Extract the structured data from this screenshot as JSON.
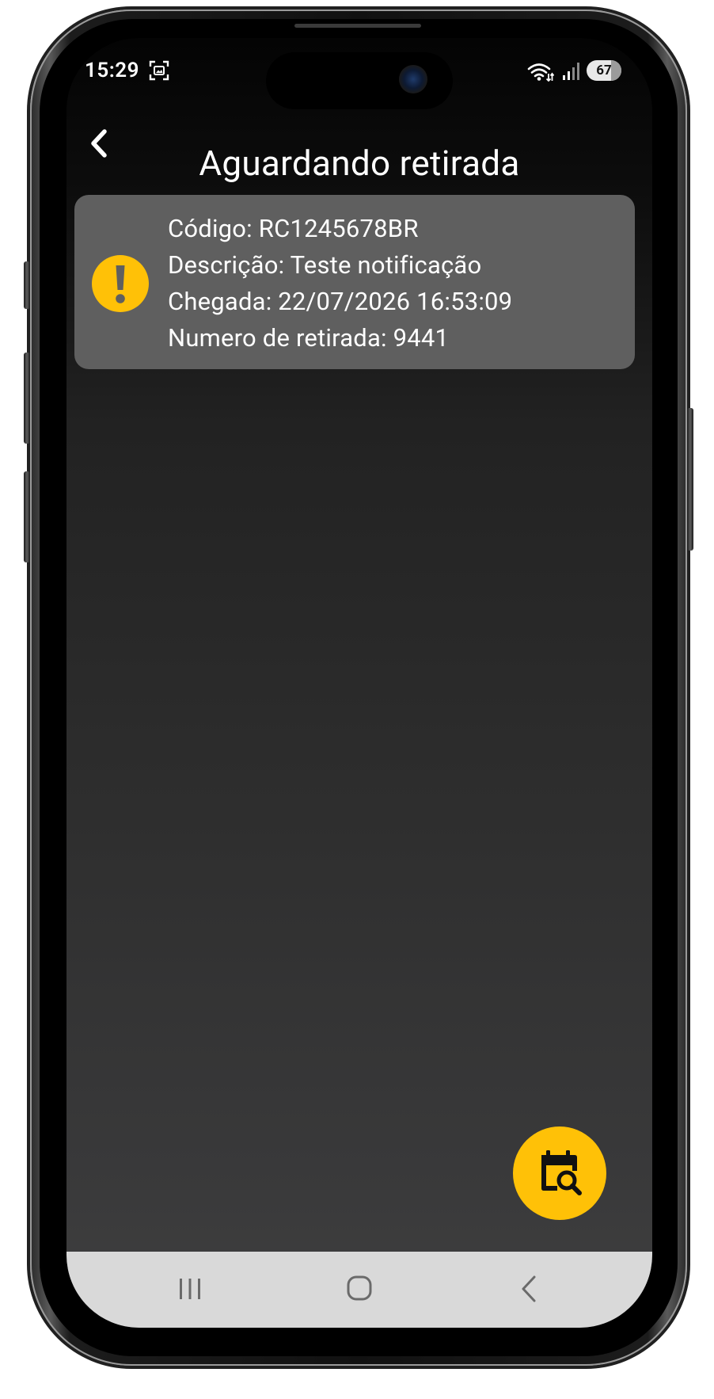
{
  "status_bar": {
    "time": "15:29",
    "battery": "67",
    "icons": [
      "screenshot-indicator-icon",
      "wifi-icon",
      "signal-icon"
    ]
  },
  "header": {
    "title": "Aguardando retirada",
    "back_icon": "chevron-left-icon"
  },
  "package_card": {
    "status_icon": "exclamation-circle-icon",
    "codigo": "Código: RC1245678BR",
    "descricao": "Descrição: Teste notificação",
    "chegada": "Chegada: 22/07/2026 16:53:09",
    "numero_retirada": "Numero de retirada: 9441"
  },
  "fab": {
    "icon": "calendar-search-icon"
  },
  "nav_bar": {
    "items": [
      "recent-apps-icon",
      "home-icon",
      "back-icon"
    ]
  },
  "colors": {
    "accent": "#ffc107",
    "card_background": "#5f5f5f",
    "nav_background": "#d9d9d9"
  }
}
